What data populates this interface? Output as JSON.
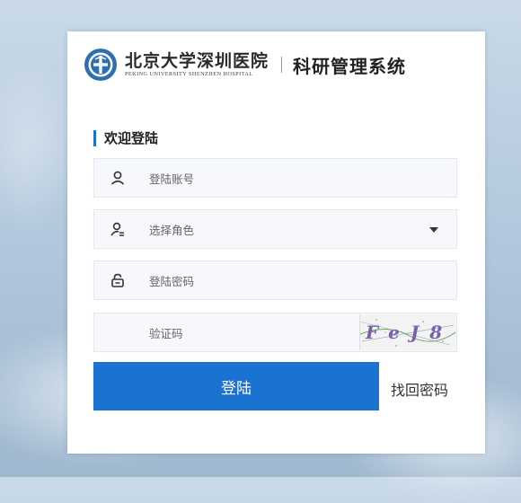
{
  "header": {
    "logo_cn": "北京大学深圳医院",
    "logo_en": "PEKING UNIVERSITY SHENZHEN HOSPITAL",
    "system_title": "科研管理系统"
  },
  "login": {
    "section_title": "欢迎登陆",
    "username_placeholder": "登陆账号",
    "role_placeholder": "选择角色",
    "password_placeholder": "登陆密码",
    "captcha_placeholder": "验证码",
    "captcha_text": "FeJ8",
    "login_label": "登陆",
    "forgot_label": "找回密码"
  },
  "colors": {
    "accent": "#1a73d1"
  },
  "icons": {
    "username": "user-icon",
    "role": "user-role-icon",
    "password": "lock-icon",
    "role_dropdown": "caret-down-icon"
  }
}
